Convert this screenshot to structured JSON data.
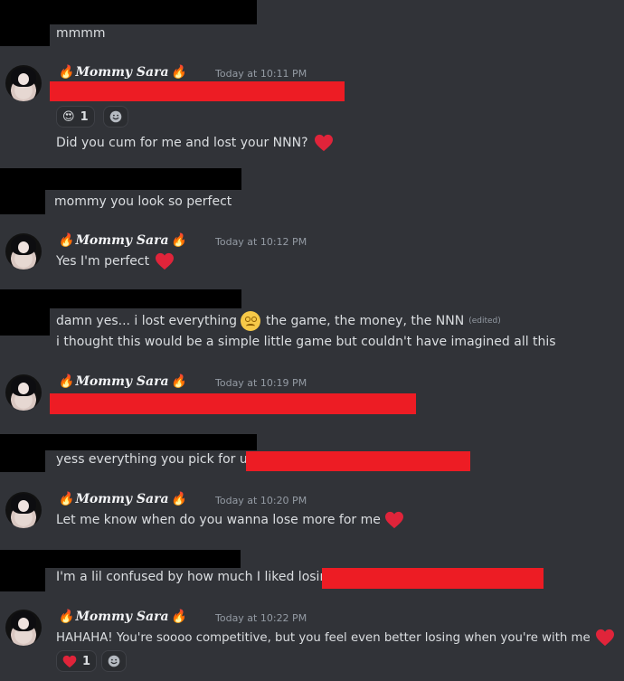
{
  "author": {
    "display_name": "Mommy Sara",
    "fire_emoji": "🔥"
  },
  "messages": [
    {
      "id": "m1",
      "type": "user",
      "text": "mmmm"
    },
    {
      "id": "m2",
      "type": "sara",
      "timestamp": "Today at 10:11 PM",
      "reactions": [
        {
          "emoji": "😍",
          "count": "1"
        }
      ],
      "text": "Did you cum for me and lost your NNN?"
    },
    {
      "id": "m3",
      "type": "user",
      "text": "mommy you look so perfect"
    },
    {
      "id": "m4",
      "type": "sara",
      "timestamp": "Today at 10:12 PM",
      "text": "Yes I'm perfect"
    },
    {
      "id": "m5",
      "type": "user",
      "text_before_emoji": "damn yes... i lost everything",
      "text_after_emoji": "the game, the money, the NNN",
      "edited": "(edited)",
      "line2": "i thought this would be a simple little game but couldn't have imagined all this"
    },
    {
      "id": "m6",
      "type": "sara",
      "timestamp": "Today at 10:19 PM"
    },
    {
      "id": "m7",
      "type": "user",
      "text": "yess everything you pick for us"
    },
    {
      "id": "m8",
      "type": "sara",
      "timestamp": "Today at 10:20 PM",
      "text": "Let me know when do you wanna lose more for me"
    },
    {
      "id": "m9",
      "type": "user",
      "text": "I'm a lil confused by how much I liked losing"
    },
    {
      "id": "m10",
      "type": "sara",
      "timestamp": "Today at 10:22 PM",
      "reactions": [
        {
          "emoji": "❤️",
          "count": "1"
        }
      ],
      "text": "HAHAHA! You're soooo competitive, but you feel even better losing when you're with me"
    }
  ],
  "icons": {
    "heart": "heart-icon",
    "add_reaction": "add-reaction-icon",
    "woozy": "woozy-face-icon",
    "heart_eyes": "heart-eyes-icon"
  },
  "colors": {
    "background": "#313338",
    "text": "#dbdee1",
    "timestamp": "#949ba4",
    "redaction_red": "#ed1c24",
    "redaction_black": "#000000",
    "heart": "#e0243a"
  }
}
